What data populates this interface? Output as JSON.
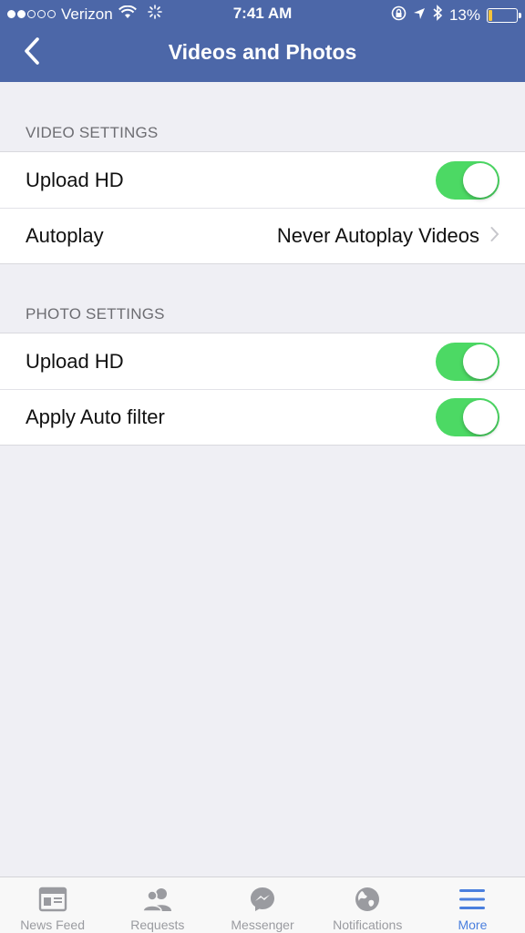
{
  "status_bar": {
    "carrier": "Verizon",
    "time": "7:41 AM",
    "battery_percent_text": "13%",
    "battery_level": 0.13,
    "signal_filled": 2,
    "signal_total": 5
  },
  "nav": {
    "title": "Videos and Photos",
    "back_icon": "chevron-left-icon"
  },
  "video_settings": {
    "header": "VIDEO SETTINGS",
    "rows": [
      {
        "label": "Upload HD",
        "toggle_on": true
      },
      {
        "label": "Autoplay",
        "value": "Never Autoplay Videos"
      }
    ]
  },
  "photo_settings": {
    "header": "PHOTO SETTINGS",
    "rows": [
      {
        "label": "Upload HD",
        "toggle_on": true
      },
      {
        "label": "Apply Auto filter",
        "toggle_on": true
      }
    ]
  },
  "tabbar": {
    "tabs": [
      {
        "label": "News Feed",
        "icon": "news-feed-icon",
        "active": false
      },
      {
        "label": "Requests",
        "icon": "friend-requests-icon",
        "active": false
      },
      {
        "label": "Messenger",
        "icon": "messenger-icon",
        "active": false
      },
      {
        "label": "Notifications",
        "icon": "globe-icon",
        "active": false
      },
      {
        "label": "More",
        "icon": "hamburger-menu-icon",
        "active": true
      }
    ]
  },
  "colors": {
    "header_bg": "#4c67a8",
    "toggle_on": "#4cd964",
    "tab_active": "#4a7fde",
    "tab_inactive": "#9a9ba0"
  }
}
